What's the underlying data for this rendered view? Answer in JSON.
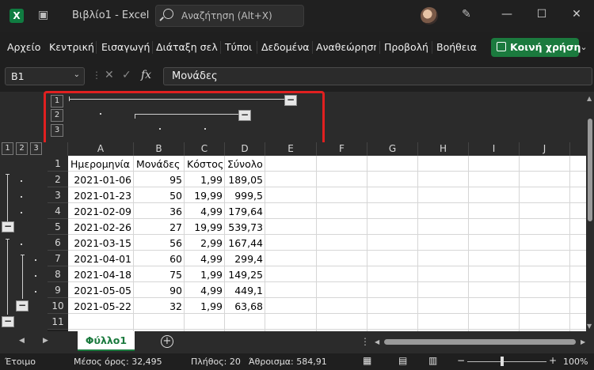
{
  "titlebar": {
    "title": "Βιβλίο1  -  Excel",
    "search_placeholder": "Αναζήτηση (Alt+X)",
    "minimize": "—",
    "maximize": "☐",
    "close": "✕"
  },
  "ribbon": {
    "tabs": [
      "Αρχείο",
      "Κεντρική",
      "Εισαγωγή",
      "Διάταξη σελί",
      "Τύποι",
      "Δεδομένα",
      "Αναθεώρηση",
      "Προβολή",
      "Βοήθεια"
    ],
    "share_label": "Κοινή χρήση"
  },
  "formula_bar": {
    "name_box": "B1",
    "formula": "Μονάδες"
  },
  "outline": {
    "column_levels": [
      "1",
      "2",
      "3"
    ],
    "row_levels": [
      "1",
      "2",
      "3"
    ]
  },
  "columns": [
    "A",
    "B",
    "C",
    "D",
    "E",
    "F",
    "G",
    "H",
    "I",
    "J"
  ],
  "rows": [
    "1",
    "2",
    "3",
    "4",
    "5",
    "6",
    "7",
    "8",
    "9",
    "10",
    "11"
  ],
  "table": {
    "headers": [
      "Ημερομηνία",
      "Μονάδες",
      "Κόστος",
      "Σύνολο"
    ],
    "data": [
      [
        "2021-01-06",
        "95",
        "1,99",
        "189,05"
      ],
      [
        "2021-01-23",
        "50",
        "19,99",
        "999,5"
      ],
      [
        "2021-02-09",
        "36",
        "4,99",
        "179,64"
      ],
      [
        "2021-02-26",
        "27",
        "19,99",
        "539,73"
      ],
      [
        "2021-03-15",
        "56",
        "2,99",
        "167,44"
      ],
      [
        "2021-04-01",
        "60",
        "4,99",
        "299,4"
      ],
      [
        "2021-04-18",
        "75",
        "1,99",
        "149,25"
      ],
      [
        "2021-05-05",
        "90",
        "4,99",
        "449,1"
      ],
      [
        "2021-05-22",
        "32",
        "1,99",
        "63,68"
      ]
    ]
  },
  "sheet_tabs": {
    "active": "Φύλλο1"
  },
  "status": {
    "ready": "Έτοιμο",
    "average": "Μέσος όρος: 32,495",
    "count": "Πλήθος: 20",
    "sum": "Άθροισμα: 584,91",
    "zoom": "100%"
  },
  "colors": {
    "accent": "#1b7a3e",
    "highlight": "#e02020"
  }
}
